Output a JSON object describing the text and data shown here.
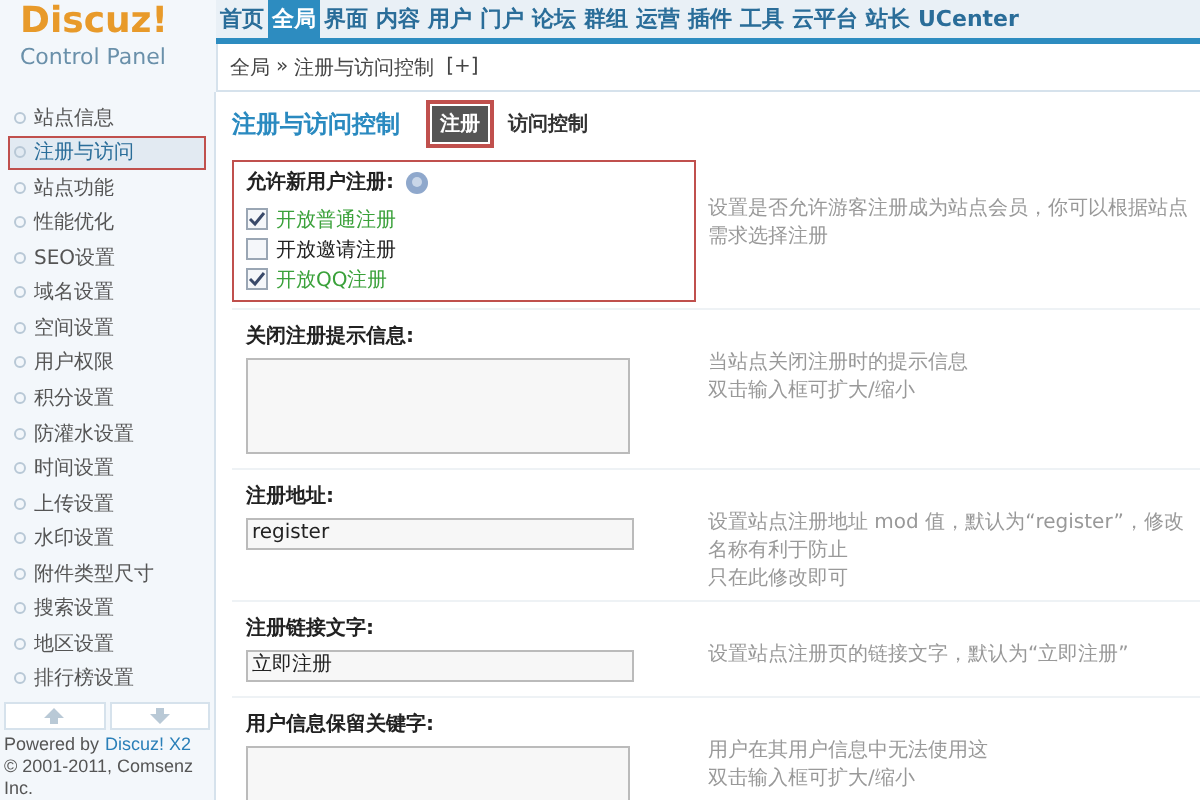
{
  "logo": {
    "name": "Discuz!",
    "subtitle": "Control Panel"
  },
  "nav": [
    {
      "label": "首页",
      "selected": false
    },
    {
      "label": "全局",
      "selected": true
    },
    {
      "label": "界面",
      "selected": false
    },
    {
      "label": "内容",
      "selected": false
    },
    {
      "label": "用户",
      "selected": false
    },
    {
      "label": "门户",
      "selected": false
    },
    {
      "label": "论坛",
      "selected": false
    },
    {
      "label": "群组",
      "selected": false
    },
    {
      "label": "运营",
      "selected": false
    },
    {
      "label": "插件",
      "selected": false
    },
    {
      "label": "工具",
      "selected": false
    },
    {
      "label": "云平台",
      "selected": false
    },
    {
      "label": "站长",
      "selected": false
    },
    {
      "label": "UCenter",
      "selected": false
    }
  ],
  "breadcrumb": {
    "root": "全局",
    "separator": "»",
    "current": "注册与访问控制",
    "toggle": "[+]"
  },
  "sidebar": {
    "items": [
      {
        "label": "站点信息",
        "selected": false
      },
      {
        "label": "注册与访问",
        "selected": true
      },
      {
        "label": "站点功能",
        "selected": false
      },
      {
        "label": "性能优化",
        "selected": false
      },
      {
        "label": "SEO设置",
        "selected": false
      },
      {
        "label": "域名设置",
        "selected": false
      },
      {
        "label": "空间设置",
        "selected": false
      },
      {
        "label": "用户权限",
        "selected": false
      },
      {
        "label": "积分设置",
        "selected": false
      },
      {
        "label": "防灌水设置",
        "selected": false
      },
      {
        "label": "时间设置",
        "selected": false
      },
      {
        "label": "上传设置",
        "selected": false
      },
      {
        "label": "水印设置",
        "selected": false
      },
      {
        "label": "附件类型尺寸",
        "selected": false
      },
      {
        "label": "搜索设置",
        "selected": false
      },
      {
        "label": "地区设置",
        "selected": false
      },
      {
        "label": "排行榜设置",
        "selected": false
      }
    ],
    "footer": {
      "powered_by": "Powered by",
      "product": "Discuz! X2",
      "copyright": "© 2001-2011, Comsenz Inc."
    }
  },
  "page": {
    "title": "注册与访问控制",
    "tabs": [
      {
        "label": "注册",
        "selected": true
      },
      {
        "label": "访问控制",
        "selected": false
      }
    ]
  },
  "settings": [
    {
      "kind": "checkboxes",
      "label": "允许新用户注册:",
      "highlighted": true,
      "options": [
        {
          "label": "开放普通注册",
          "checked": true
        },
        {
          "label": "开放邀请注册",
          "checked": false
        },
        {
          "label": "开放QQ注册",
          "checked": true
        }
      ],
      "description": [
        "设置是否允许游客注册成为站点会员，你可以根据站点需求选择注册"
      ]
    },
    {
      "kind": "textarea",
      "label": "关闭注册提示信息:",
      "highlighted": false,
      "description": [
        "当站点关闭注册时的提示信息",
        "双击输入框可扩大/缩小"
      ]
    },
    {
      "kind": "input",
      "label": "注册地址:",
      "highlighted": false,
      "value": "register",
      "description": [
        "设置站点注册地址 mod 值，默认为“register”，修改名称有利于防止",
        "只在此修改即可"
      ]
    },
    {
      "kind": "input",
      "label": "注册链接文字:",
      "highlighted": false,
      "value": "立即注册",
      "description": [
        "设置站点注册页的链接文字，默认为“立即注册”"
      ]
    },
    {
      "kind": "textarea",
      "label": "用户信息保留关键字:",
      "highlighted": false,
      "description": [
        "用户在其用户信息中无法使用这",
        "双击输入框可扩大/缩小"
      ]
    }
  ]
}
